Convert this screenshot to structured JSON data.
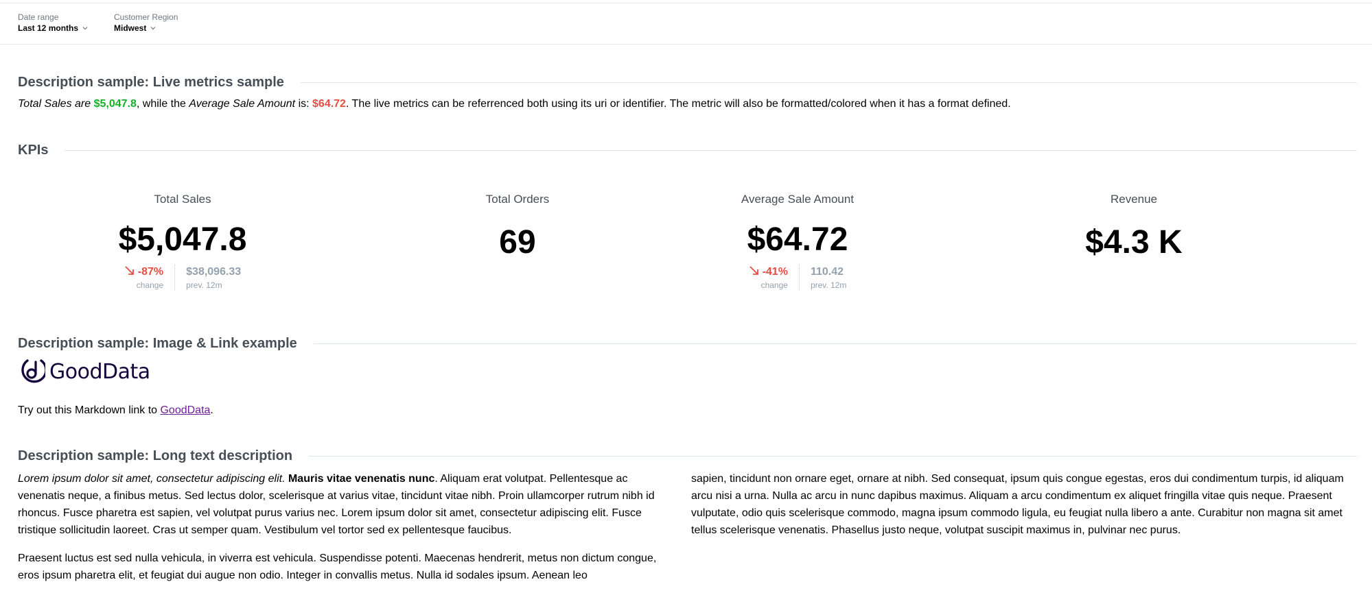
{
  "filters": [
    {
      "label": "Date range",
      "value": "Last 12 months"
    },
    {
      "label": "Customer Region",
      "value": "Midwest"
    }
  ],
  "sections": {
    "live_metrics": "Description sample: Live metrics sample",
    "kpis": "KPIs",
    "image_link": "Description sample: Image & Link example",
    "long_text": "Description sample: Long text description"
  },
  "live_metrics": {
    "p1": "Total Sales are ",
    "m1": "$5,047.8",
    "p2": ", while the ",
    "p3": "Average Sale Amount",
    "p4": " is: ",
    "m2": "$64.72",
    "p5": ". The live metrics can be referrenced both using its uri or identifier. The metric will also be formatted/colored when it has a format defined."
  },
  "kpis": [
    {
      "name": "Total Sales",
      "value": "$5,047.8",
      "change": "-87%",
      "change_label": "change",
      "prev": "$38,096.33",
      "prev_label": "prev. 12m"
    },
    {
      "name": "Total Orders",
      "value": "69"
    },
    {
      "name": "Average Sale Amount",
      "value": "$64.72",
      "change": "-41%",
      "change_label": "change",
      "prev": "110.42",
      "prev_label": "prev. 12m"
    },
    {
      "name": "Revenue",
      "value": "$4.3 K"
    }
  ],
  "logo": {
    "text": "GoodData",
    "icon": "gooddata-logo-icon"
  },
  "link_line": {
    "before": "Try out this Markdown link to ",
    "link": "GoodData",
    "after": "."
  },
  "long_text": {
    "left_p1_italic": "Lorem ipsum dolor sit amet, consectetur adipiscing elit.",
    "left_p1_bold": "Mauris vitae venenatis nunc",
    "left_p1_rest": ". Aliquam erat volutpat. Pellentesque ac venenatis neque, a finibus metus. Sed lectus dolor, scelerisque at varius vitae, tincidunt vitae nibh. Proin ullamcorper rutrum nibh id rhoncus. Fusce pharetra est sapien, vel volutpat purus varius nec. Lorem ipsum dolor sit amet, consectetur adipiscing elit. Fusce tristique sollicitudin laoreet. Cras ut semper quam. Vestibulum vel tortor sed ex pellentesque faucibus.",
    "left_p2": "Praesent luctus est sed nulla vehicula, in viverra est vehicula. Suspendisse potenti. Maecenas hendrerit, metus non dictum congue, eros ipsum pharetra elit, et feugiat dui augue non odio. Integer in convallis metus. Nulla id sodales ipsum. Aenean leo",
    "right_p1": "sapien, tincidunt non ornare eget, ornare at nibh. Sed consequat, ipsum quis congue egestas, eros dui condimentum turpis, id aliquam arcu nisi a urna. Nulla ac arcu in nunc dapibus maximus. Aliquam a arcu condimentum ex aliquet fringilla vitae quis neque. Praesent vulputate, odio quis scelerisque commodo, magna ipsum commodo ligula, eu feugiat nulla libero a ante. Curabitur non magna sit amet tellus scelerisque venenatis. Phasellus justo neque, volutpat suscipit maximus in, pulvinar nec purus."
  },
  "colors": {
    "positive": "#13b226",
    "negative": "#e54d42",
    "heading": "#464e56",
    "link": "#6d1f99",
    "muted": "#94a1ad"
  }
}
